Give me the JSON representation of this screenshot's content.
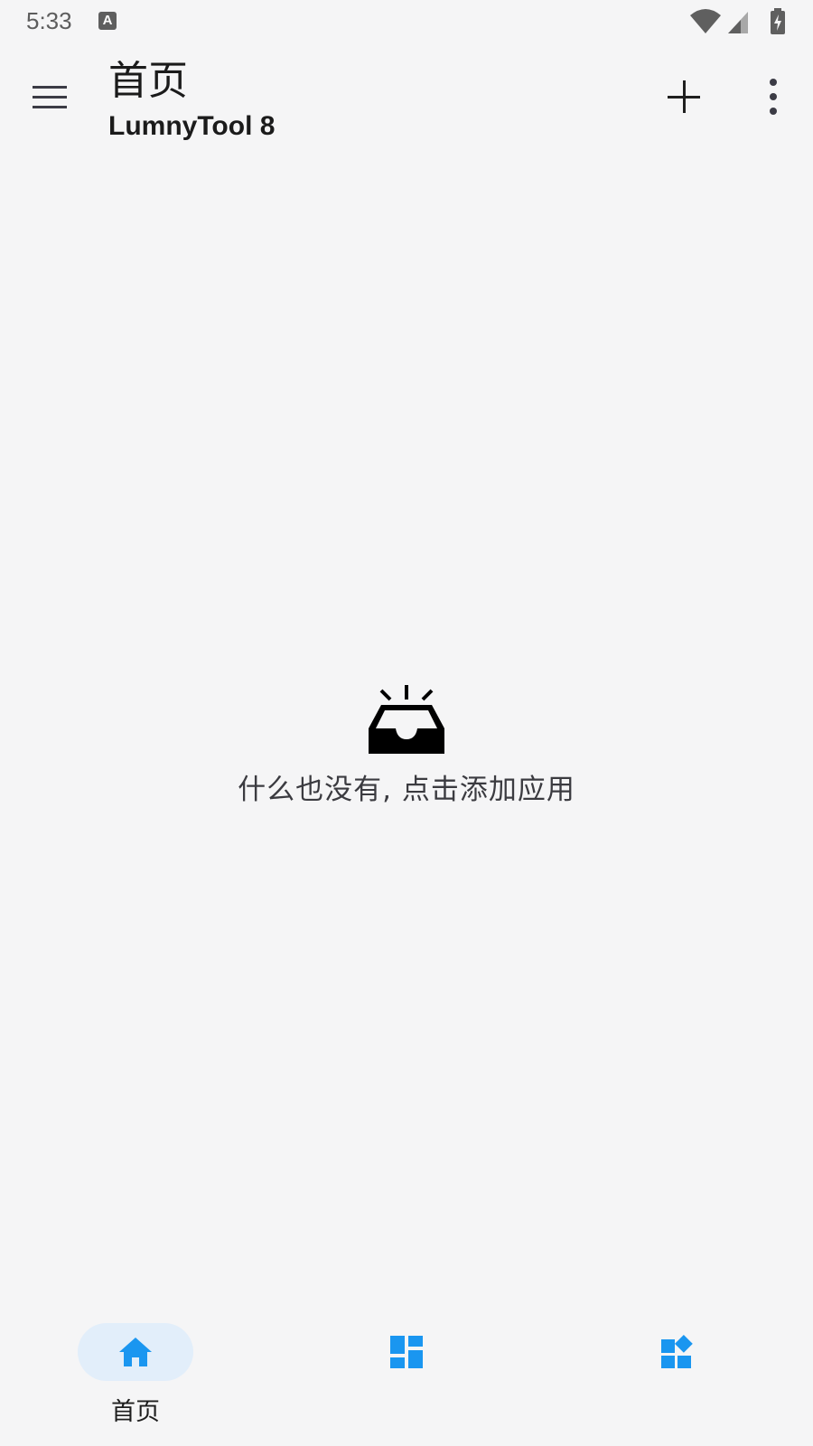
{
  "status_bar": {
    "time": "5:33",
    "notification_icon": "A",
    "icons": [
      "wifi-icon",
      "signal-icon",
      "battery-charging-icon"
    ]
  },
  "app_bar": {
    "title": "首页",
    "subtitle": "LumnyTool 8",
    "menu_icon": "hamburger-menu-icon",
    "add_icon": "plus-icon",
    "more_icon": "more-vert-icon"
  },
  "empty_state": {
    "icon": "inbox-icon",
    "message": "什么也没有, 点击添加应用"
  },
  "bottom_nav": {
    "items": [
      {
        "label": "首页",
        "icon": "home-icon",
        "selected": true
      },
      {
        "label": "",
        "icon": "dashboard-icon",
        "selected": false
      },
      {
        "label": "",
        "icon": "widgets-icon",
        "selected": false
      }
    ]
  },
  "colors": {
    "background": "#f5f5f6",
    "accent": "#1a96f0",
    "selected_pill": "#e2eefa",
    "text": "#1b1b1b"
  }
}
